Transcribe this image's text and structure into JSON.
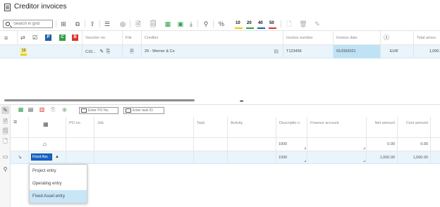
{
  "window": {
    "title": "Creditor invoices"
  },
  "toolbar": {
    "search_placeholder": "Search in grid",
    "nums": [
      "10",
      "20",
      "40",
      "50"
    ]
  },
  "grid": {
    "columns": {
      "voucher": "Voucher no.",
      "file": "File",
      "creditor": "Creditor",
      "invoice_number": "Invoice number",
      "invoice_date": "Invoice date",
      "total": "Total amou"
    },
    "flags": {
      "p": "P",
      "c": "C",
      "b": "B"
    },
    "row": {
      "badge": "19",
      "voucher": "C10...",
      "creditor": "29 - Werner & Co",
      "invoice_number": "T123456",
      "invoice_date": "01/29/2021",
      "currency": "EUR",
      "total": "1,000."
    }
  },
  "lower": {
    "po_placeholder": "Enter PO No.",
    "task_placeholder": "Enter task ID",
    "columns": {
      "po": "PO no.",
      "job": "Job",
      "task": "Task",
      "activity": "Activity",
      "description": "Descriptio n",
      "finance": "Finance account",
      "net": "Net amount",
      "cost": "Cost amount"
    },
    "row1": {
      "description": "1000",
      "net": "0.00",
      "cost": "0.00"
    },
    "row2": {
      "type_value": "Fixed Ass",
      "description": "1000",
      "net": "1,000.00",
      "cost": "1,000.00"
    }
  },
  "dropdown": {
    "options": [
      "Project entry",
      "Operating entry",
      "Fixed Asset entry"
    ],
    "selected_index": 2
  },
  "colors": {
    "selection_blue": "#1a66c7",
    "row_highlight": "#e9f4fb",
    "flag_p": "#1e5fa8",
    "flag_c": "#2e9e49",
    "flag_b": "#d9352b"
  }
}
